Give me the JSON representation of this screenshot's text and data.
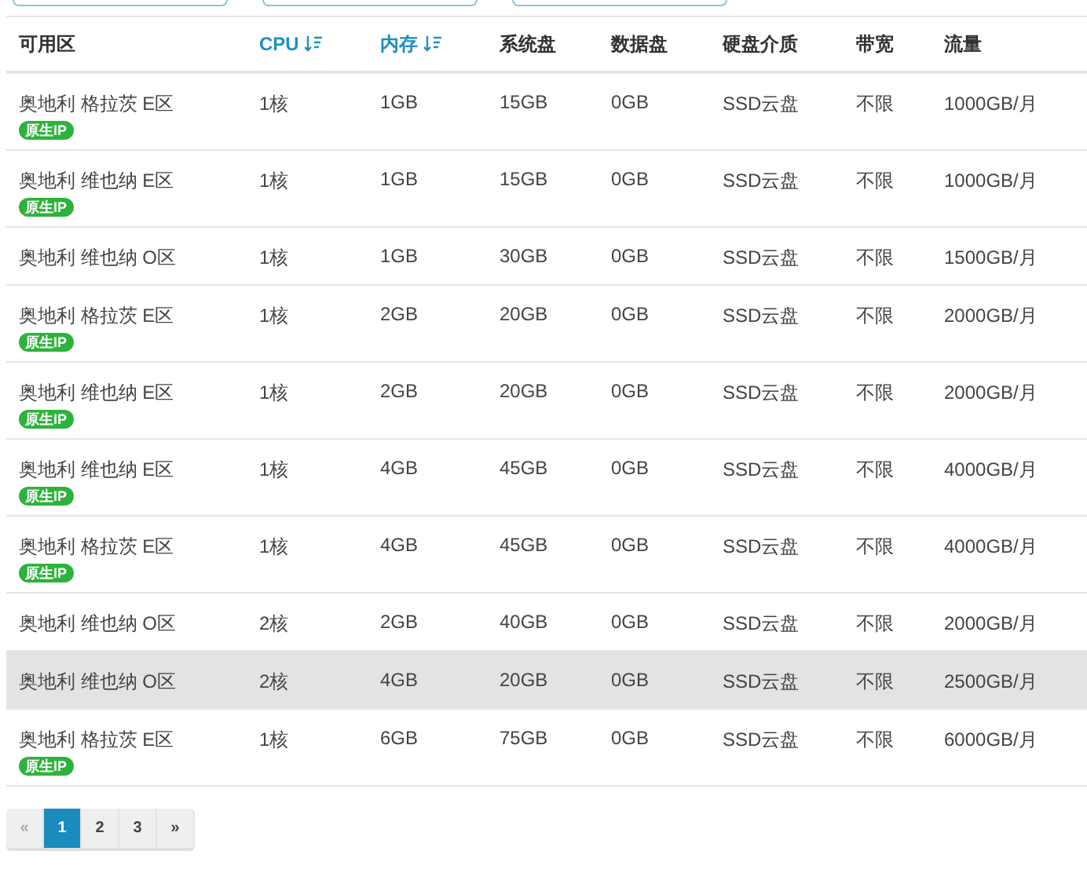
{
  "filters": [
    {
      "kind": "field"
    },
    {
      "kind": "field"
    },
    {
      "kind": "field"
    }
  ],
  "table": {
    "columns": [
      {
        "label": "可用区",
        "sortable": false
      },
      {
        "label": "CPU",
        "sortable": true
      },
      {
        "label": "内存",
        "sortable": true
      },
      {
        "label": "系统盘",
        "sortable": false
      },
      {
        "label": "数据盘",
        "sortable": false
      },
      {
        "label": "硬盘介质",
        "sortable": false
      },
      {
        "label": "带宽",
        "sortable": false
      },
      {
        "label": "流量",
        "sortable": false
      }
    ],
    "rows": [
      {
        "cells": [
          "奥地利 格拉茨 E区",
          "1核",
          "1GB",
          "15GB",
          "0GB",
          "SSD云盘",
          "不限",
          "1000GB/月"
        ],
        "badge": "原生IP",
        "highlighted": false
      },
      {
        "cells": [
          "奥地利 维也纳 E区",
          "1核",
          "1GB",
          "15GB",
          "0GB",
          "SSD云盘",
          "不限",
          "1000GB/月"
        ],
        "badge": "原生IP",
        "highlighted": false
      },
      {
        "cells": [
          "奥地利 维也纳 O区",
          "1核",
          "1GB",
          "30GB",
          "0GB",
          "SSD云盘",
          "不限",
          "1500GB/月"
        ],
        "highlighted": false
      },
      {
        "cells": [
          "奥地利 格拉茨 E区",
          "1核",
          "2GB",
          "20GB",
          "0GB",
          "SSD云盘",
          "不限",
          "2000GB/月"
        ],
        "badge": "原生IP",
        "highlighted": false
      },
      {
        "cells": [
          "奥地利 维也纳 E区",
          "1核",
          "2GB",
          "20GB",
          "0GB",
          "SSD云盘",
          "不限",
          "2000GB/月"
        ],
        "badge": "原生IP",
        "highlighted": false
      },
      {
        "cells": [
          "奥地利 维也纳 E区",
          "1核",
          "4GB",
          "45GB",
          "0GB",
          "SSD云盘",
          "不限",
          "4000GB/月"
        ],
        "badge": "原生IP",
        "highlighted": false
      },
      {
        "cells": [
          "奥地利 格拉茨 E区",
          "1核",
          "4GB",
          "45GB",
          "0GB",
          "SSD云盘",
          "不限",
          "4000GB/月"
        ],
        "badge": "原生IP",
        "highlighted": false
      },
      {
        "cells": [
          "奥地利 维也纳 O区",
          "2核",
          "2GB",
          "40GB",
          "0GB",
          "SSD云盘",
          "不限",
          "2000GB/月"
        ],
        "highlighted": false
      },
      {
        "cells": [
          "奥地利 维也纳 O区",
          "2核",
          "4GB",
          "20GB",
          "0GB",
          "SSD云盘",
          "不限",
          "2500GB/月"
        ],
        "highlighted": true
      },
      {
        "cells": [
          "奥地利 格拉茨 E区",
          "1核",
          "6GB",
          "75GB",
          "0GB",
          "SSD云盘",
          "不限",
          "6000GB/月"
        ],
        "badge": "原生IP",
        "highlighted": false
      }
    ]
  },
  "pagination": [
    {
      "label": "«",
      "selected": false,
      "disabled": true
    },
    {
      "label": "1",
      "selected": true,
      "disabled": false
    },
    {
      "label": "2",
      "selected": false,
      "disabled": false
    },
    {
      "label": "3",
      "selected": false,
      "disabled": false
    },
    {
      "label": "»",
      "selected": false,
      "disabled": false
    }
  ]
}
